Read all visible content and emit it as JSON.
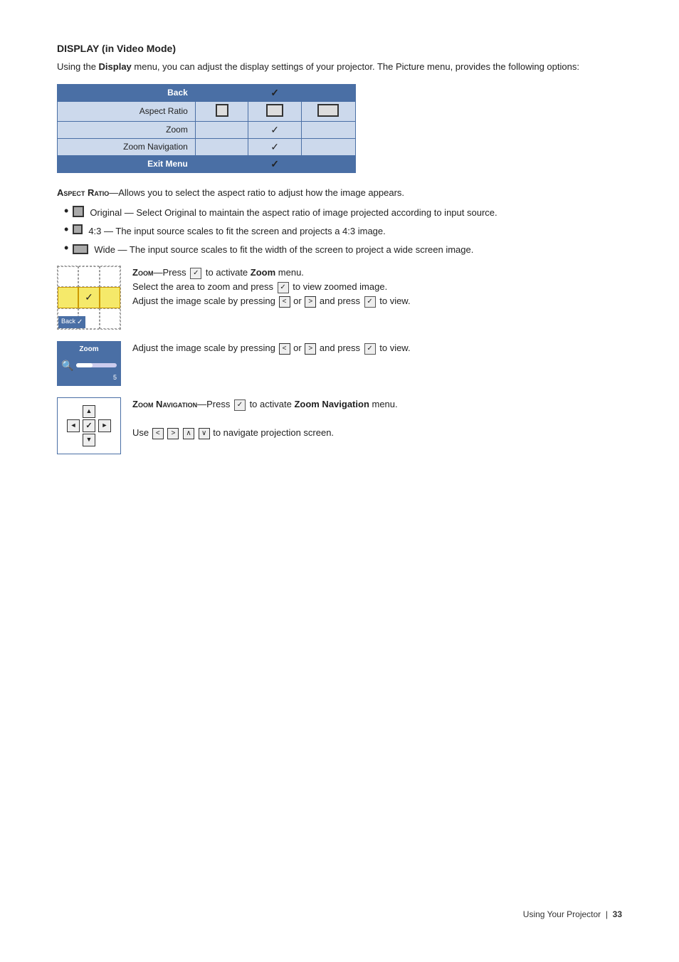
{
  "page": {
    "title": "DISPLAY (in Video Mode)",
    "intro": "Using the Display menu, you can adjust the display settings of your projector. The Picture menu, provides the following options:",
    "menu_table": {
      "rows": [
        {
          "label": "Back",
          "col2": "",
          "col3": "✓",
          "col4": "",
          "type": "header"
        },
        {
          "label": "Aspect Ratio",
          "col2": "square",
          "col3": "square-sm",
          "col4": "wide",
          "type": "item"
        },
        {
          "label": "Zoom",
          "col2": "",
          "col3": "✓",
          "col4": "",
          "type": "item"
        },
        {
          "label": "Zoom Navigation",
          "col2": "",
          "col3": "✓",
          "col4": "",
          "type": "item"
        },
        {
          "label": "Exit Menu",
          "col2": "",
          "col3": "✓",
          "col4": "",
          "type": "exit"
        }
      ]
    },
    "aspect_ratio": {
      "label": "Aspect Ratio",
      "description": "—Allows you to select the aspect ratio to adjust how the image appears.",
      "bullets": [
        {
          "icon": "square-gray",
          "text": "Original — Select Original to maintain the aspect ratio of image projected according to input source."
        },
        {
          "icon": "square-dark",
          "text": "4:3 — The input source scales to fit the screen and projects a 4:3 image."
        },
        {
          "icon": "wide-gray",
          "text": "Wide — The input source scales to fit the width of the screen to project a wide screen image."
        }
      ]
    },
    "zoom": {
      "label": "Zoom",
      "description_1": "—Press",
      "check_icon": "✓",
      "description_2": "to activate Zoom menu.",
      "description_3": "Select the area to zoom and press",
      "description_4": "to view zoomed image.",
      "description_5": "Adjust the image scale by pressing",
      "description_6": "or",
      "description_7": "and press",
      "description_8": "to view.",
      "grid_back_label": "Back",
      "slider_title": "Zoom",
      "slider_number": "5",
      "slider_text_1": "Adjust the image scale by pressing",
      "slider_text_2": "or",
      "slider_text_3": "and press",
      "slider_text_4": "to view."
    },
    "zoom_navigation": {
      "label": "Zoom Navigation",
      "description_1": "—Press",
      "description_2": "to activate Zoom Navigation menu.",
      "description_3": "Use",
      "description_4": "to navigate projection screen."
    },
    "footer": {
      "text": "Using Your Projector",
      "separator": "|",
      "page_number": "33"
    }
  }
}
